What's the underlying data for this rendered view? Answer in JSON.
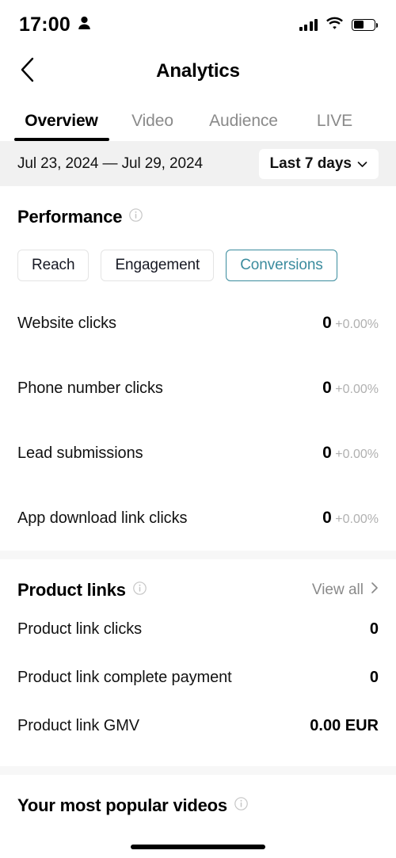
{
  "status_bar": {
    "time": "17:00",
    "person_icon": "person-icon",
    "signal_icon": "signal-bars-icon",
    "wifi_icon": "wifi-icon",
    "battery_icon": "battery-icon",
    "battery_level_percent": 52
  },
  "header": {
    "back_icon": "chevron-left-icon",
    "title": "Analytics"
  },
  "tabs": [
    {
      "label": "Overview",
      "active": true
    },
    {
      "label": "Video",
      "active": false
    },
    {
      "label": "Audience",
      "active": false
    },
    {
      "label": "LIVE",
      "active": false
    }
  ],
  "date_bar": {
    "range_text": "Jul 23, 2024 — Jul 29, 2024",
    "selector_label": "Last 7 days",
    "selector_icon": "chevron-down-icon"
  },
  "performance": {
    "title": "Performance",
    "info_icon": "info-icon",
    "chips": [
      {
        "label": "Reach",
        "selected": false
      },
      {
        "label": "Engagement",
        "selected": false
      },
      {
        "label": "Conversions",
        "selected": true
      }
    ],
    "metrics": [
      {
        "label": "Website clicks",
        "value": "0",
        "delta": "+0.00%"
      },
      {
        "label": "Phone number clicks",
        "value": "0",
        "delta": "+0.00%"
      },
      {
        "label": "Lead submissions",
        "value": "0",
        "delta": "+0.00%"
      },
      {
        "label": "App download link clicks",
        "value": "0",
        "delta": "+0.00%"
      }
    ]
  },
  "product_links": {
    "title": "Product links",
    "info_icon": "info-icon",
    "view_all_label": "View all",
    "view_all_icon": "chevron-right-icon",
    "rows": [
      {
        "label": "Product link clicks",
        "value": "0"
      },
      {
        "label": "Product link complete payment",
        "value": "0"
      },
      {
        "label": "Product link GMV",
        "value": "0.00 EUR"
      }
    ]
  },
  "popular_videos": {
    "title": "Your most popular videos",
    "info_icon": "info-icon"
  },
  "colors": {
    "accent": "#3b8c9e",
    "text_primary": "#121212",
    "text_muted": "#8a8a8a",
    "delta_muted": "#b0b0b0",
    "band": "#f1f1f1",
    "divider": "#f7f7f7"
  }
}
